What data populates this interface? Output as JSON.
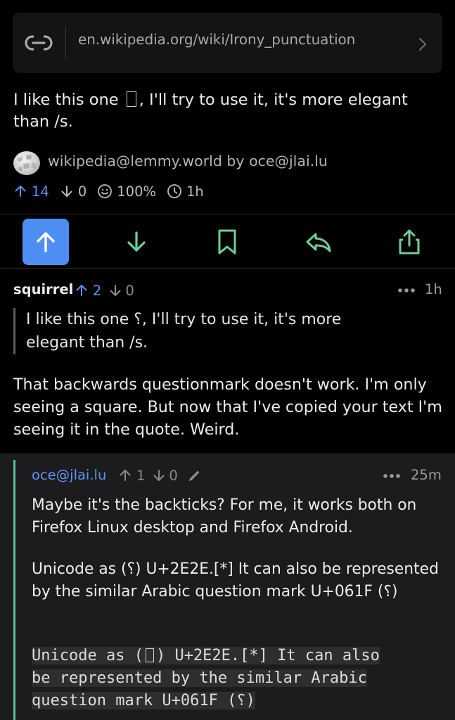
{
  "link_card": {
    "url": "en.wikipedia.org/wiki/Irony_punctuation"
  },
  "post": {
    "text_before": "I like this one ",
    "text_after": ", I'll try to use it, it's more elegant than /s.",
    "community": "wikipedia@lemmy.world",
    "by_label": "by",
    "author": "oce@jlai.lu",
    "upvotes": "14",
    "downvotes": "0",
    "ratio": "100%",
    "age": "1h"
  },
  "comments": [
    {
      "author": "squirrel",
      "upvotes": "2",
      "downvotes": "0",
      "age": "1h",
      "quote": "I like this one ⸮, I'll try to use it, it's more elegant than /s.",
      "body": "That backwards questionmark doesn't work. I'm only seeing a square. But now that I've copied your text I'm seeing it in the quote. Weird."
    },
    {
      "author": "oce@jlai.lu",
      "upvotes": "1",
      "downvotes": "0",
      "age": "25m",
      "paragraph1": "Maybe it's the backticks? For me, it works both on Firefox Linux desktop and Firefox Android.",
      "paragraph2": "Unicode as (⸮) U+2E2E.[*] It can also be represented by the similar Arabic question mark U+061F (؟)",
      "code_line1_before": "Unicode as (",
      "code_line1_after": ") U+2E2E.[*] It can also",
      "code_line2": "be represented by the similar Arabic",
      "code_line3": "question mark U+061F (؟)"
    }
  ],
  "colors": {
    "accent": "#4e8ef3",
    "action_green": "#6fcf97",
    "thread_bar": "#5dbb9c"
  }
}
